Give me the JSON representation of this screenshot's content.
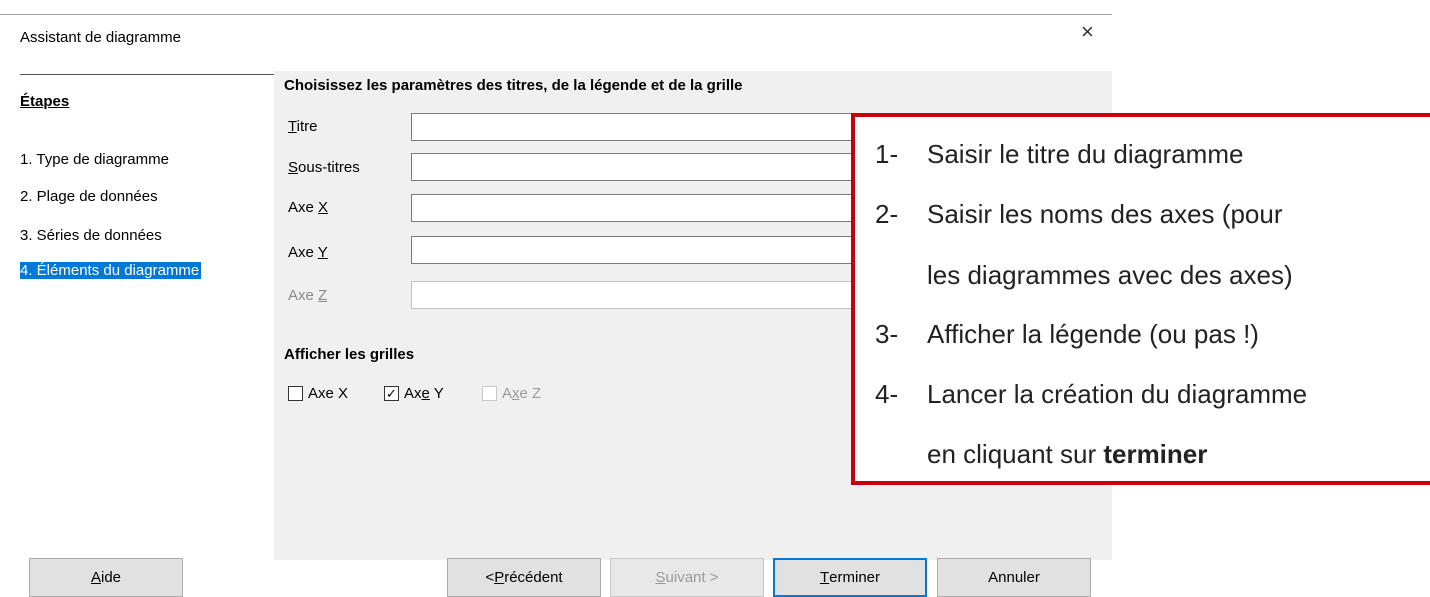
{
  "window": {
    "title": "Assistant de diagramme",
    "close_glyph": "×"
  },
  "steps": {
    "heading": "Étapes",
    "items": [
      {
        "label": "1. Type de diagramme",
        "active": false
      },
      {
        "label": "2. Plage de données",
        "active": false
      },
      {
        "label": "3. Séries de données",
        "active": false
      },
      {
        "label": "4. Éléments du diagramme",
        "active": true
      }
    ]
  },
  "panel": {
    "heading": "Choisissez les paramètres des titres, de la légende et de la grille",
    "fields": [
      {
        "label": "Titre",
        "value": "",
        "enabled": true
      },
      {
        "label": "Sous-titres",
        "value": "",
        "enabled": true
      },
      {
        "label": "Axe X",
        "value": "",
        "enabled": true
      },
      {
        "label": "Axe Y",
        "value": "",
        "enabled": true
      },
      {
        "label": "Axe Z",
        "value": "",
        "enabled": false
      }
    ],
    "grid_heading": "Afficher les grilles",
    "grid_checkboxes": [
      {
        "label": "Axe X",
        "checked": false,
        "enabled": true
      },
      {
        "label": "Axe Y",
        "checked": true,
        "enabled": true
      },
      {
        "label": "Axe Z",
        "checked": false,
        "enabled": false
      }
    ]
  },
  "buttons": {
    "help": "Aide",
    "previous": "< Précédent",
    "next": "Suivant >",
    "finish": "Terminer",
    "cancel": "Annuler"
  },
  "callout": {
    "items": [
      {
        "num": "1-",
        "text": "Saisir le titre du diagramme"
      },
      {
        "num": "2-",
        "text": "Saisir les noms des axes (pour",
        "continuation": "les diagrammes avec des axes)"
      },
      {
        "num": "3-",
        "text": "Afficher la légende (ou pas !)"
      },
      {
        "num": "4-",
        "text": "Lancer la création du diagramme",
        "continuation_prefix": "en cliquant sur ",
        "continuation_bold": "terminer"
      }
    ]
  },
  "colors": {
    "accent": "#0078d7",
    "callout_border": "#c8000a",
    "panel_bg": "#f0f0f0"
  }
}
